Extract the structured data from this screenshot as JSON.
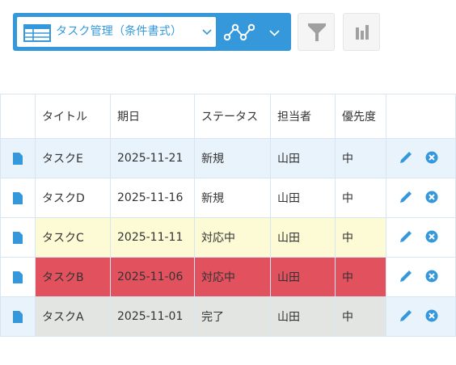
{
  "toolbar": {
    "view_name": "タスク管理（条件書式）",
    "icons": {
      "view_type": "table-icon",
      "view_caret": "chevron-down-icon",
      "graph": "line-graph-icon",
      "graph_caret": "chevron-down-icon",
      "filter": "filter-funnel-icon",
      "chart": "bar-chart-icon"
    },
    "accent_color": "#3498db"
  },
  "table": {
    "headers": [
      "",
      "タイトル",
      "期日",
      "ステータス",
      "担当者",
      "優先度",
      ""
    ],
    "rows": [
      {
        "title": "タスクE",
        "due": "2025-11-21",
        "status": "新規",
        "assignee": "山田",
        "priority": "中",
        "highlight": "none"
      },
      {
        "title": "タスクD",
        "due": "2025-11-16",
        "status": "新規",
        "assignee": "山田",
        "priority": "中",
        "highlight": "none"
      },
      {
        "title": "タスクC",
        "due": "2025-11-11",
        "status": "対応中",
        "assignee": "山田",
        "priority": "中",
        "highlight": "#fdfbd6"
      },
      {
        "title": "タスクB",
        "due": "2025-11-06",
        "status": "対応中",
        "assignee": "山田",
        "priority": "中",
        "highlight": "#e2515e"
      },
      {
        "title": "タスクA",
        "due": "2025-11-01",
        "status": "完了",
        "assignee": "山田",
        "priority": "中",
        "highlight": "#e3e5e3"
      }
    ],
    "row_icons": {
      "record": "document-icon",
      "edit": "pencil-edit-icon",
      "delete": "close-circle-icon"
    }
  }
}
